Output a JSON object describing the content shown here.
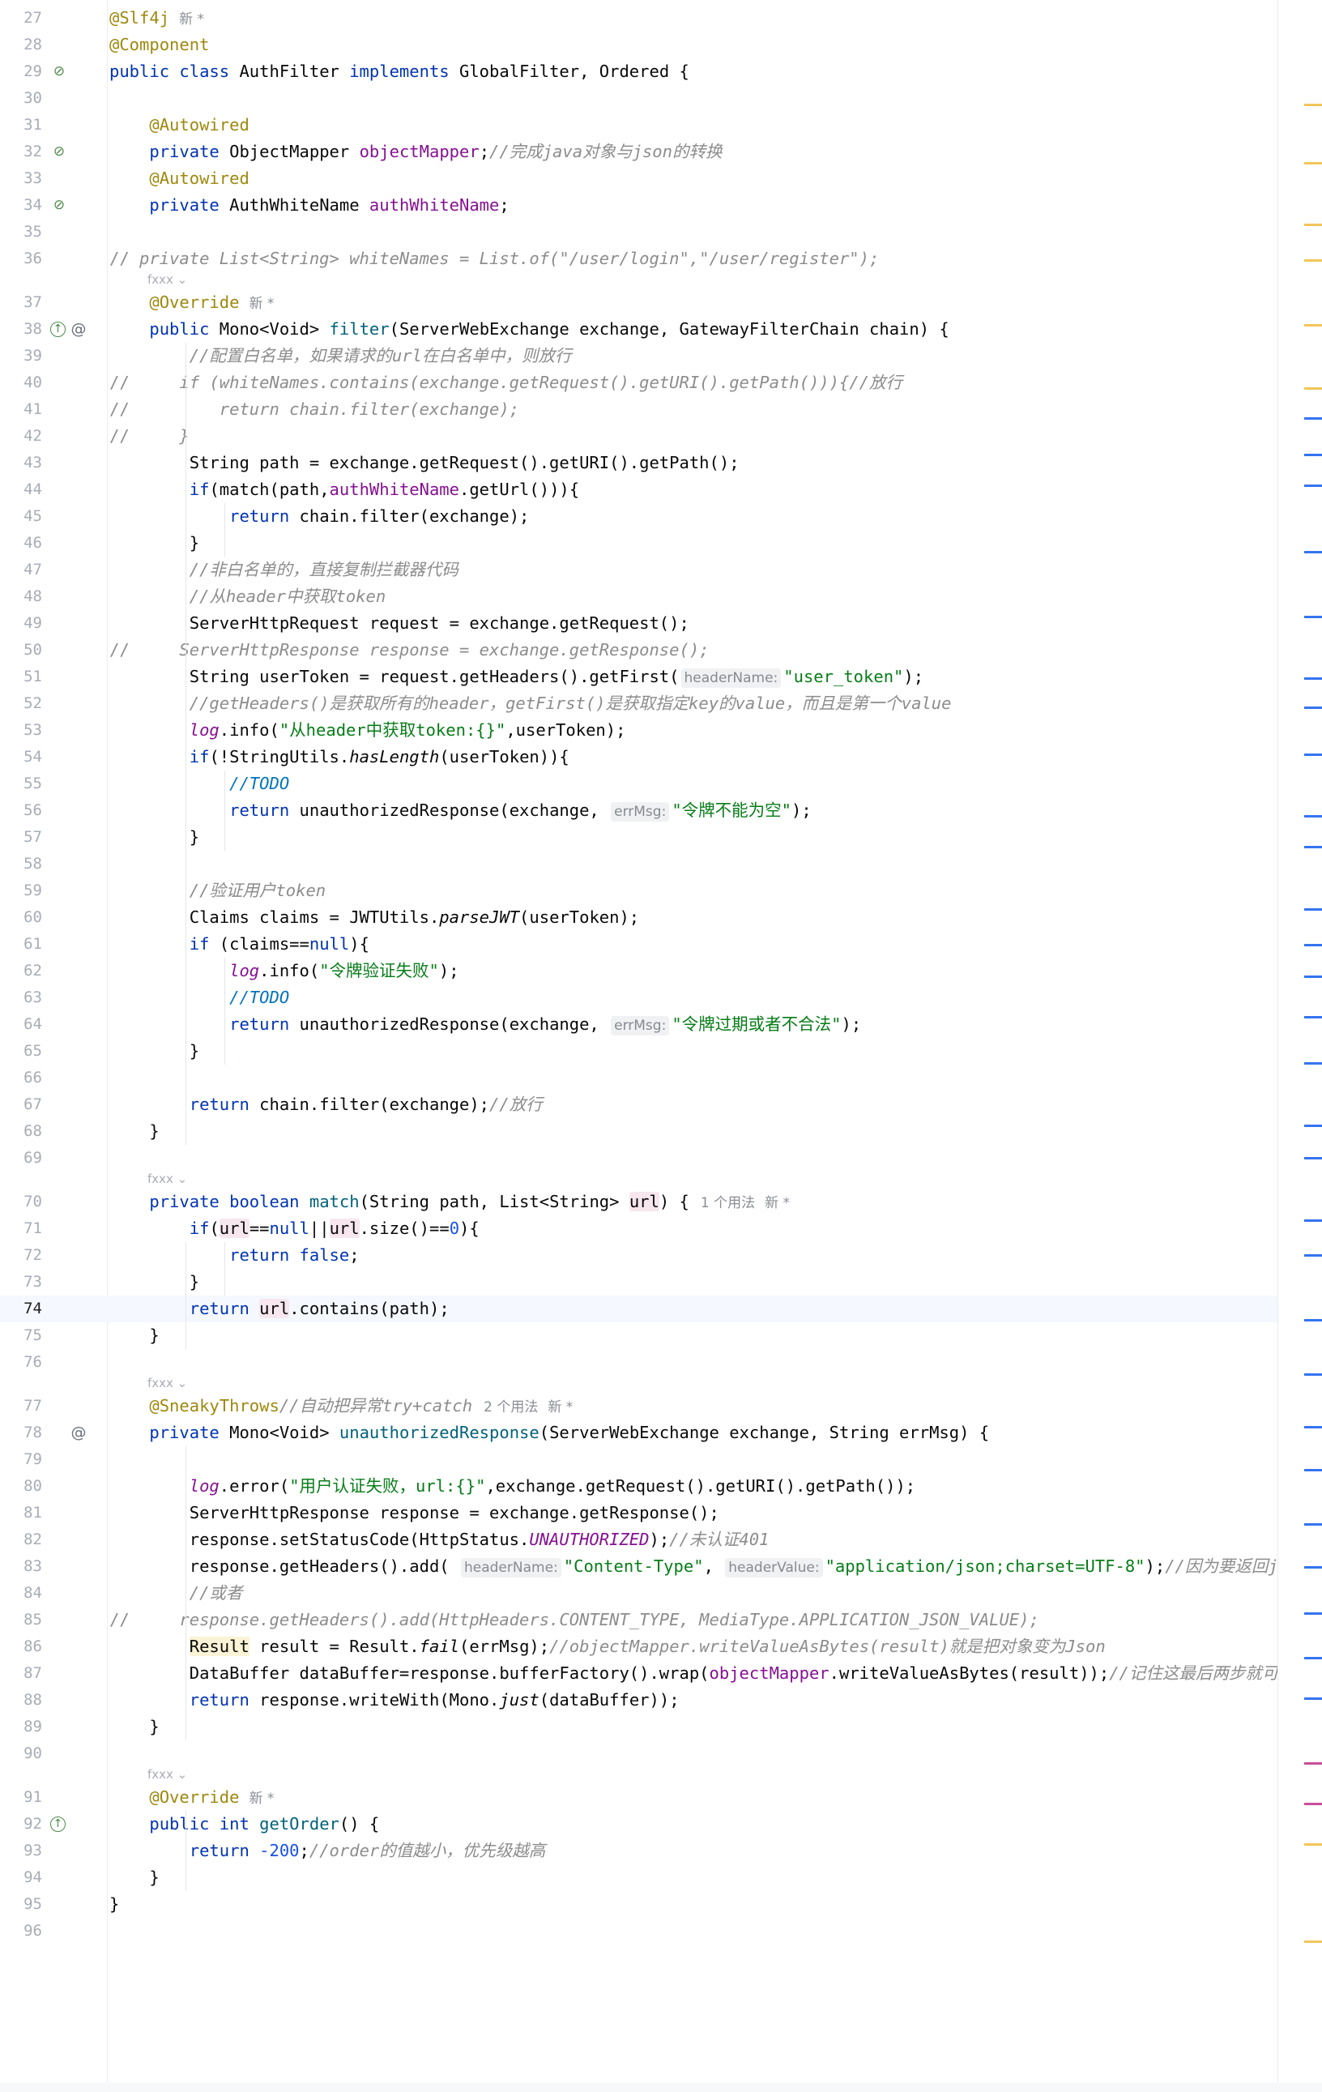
{
  "editor": {
    "gutter_authors": [
      "fxxx",
      "fxxx",
      "fxxx",
      "fxxx"
    ],
    "lines": [
      {
        "n": "27",
        "tokens": [
          [
            "an",
            "@Slf4j"
          ]
        ],
        "tail": {
          "newmark": "新 *"
        }
      },
      {
        "n": "28",
        "tokens": [
          [
            "an",
            "@Component"
          ]
        ]
      },
      {
        "n": "29",
        "icon": "bean",
        "tokens": [
          [
            "kw",
            "public class "
          ],
          [
            "",
            "AuthFilter "
          ],
          [
            "kw",
            "implements "
          ],
          [
            "",
            "GlobalFilter, Ordered {"
          ]
        ]
      },
      {
        "n": "30",
        "tokens": []
      },
      {
        "n": "31",
        "tokens": [
          [
            "",
            "    "
          ],
          [
            "an",
            "@Autowired"
          ]
        ]
      },
      {
        "n": "32",
        "icon": "bean",
        "tokens": [
          [
            "",
            "    "
          ],
          [
            "kw",
            "private "
          ],
          [
            "",
            "ObjectMapper "
          ],
          [
            "fd",
            "objectMapper"
          ],
          [
            "",
            ";"
          ],
          [
            "cm",
            "//完成java对象与json的转换"
          ]
        ]
      },
      {
        "n": "33",
        "tokens": [
          [
            "",
            "    "
          ],
          [
            "an",
            "@Autowired"
          ]
        ]
      },
      {
        "n": "34",
        "icon": "bean",
        "tokens": [
          [
            "",
            "    "
          ],
          [
            "kw",
            "private "
          ],
          [
            "",
            "AuthWhiteName "
          ],
          [
            "fd",
            "authWhiteName"
          ],
          [
            "",
            ";"
          ]
        ]
      },
      {
        "n": "35",
        "tokens": []
      },
      {
        "n": "36",
        "comment_prefix": "//",
        "tokens": [
          [
            "cm",
            "   private List<String> whiteNames = List.of(\"/user/login\",\"/user/register\");"
          ]
        ]
      },
      {
        "n": "37",
        "tokens": [
          [
            "",
            "    "
          ],
          [
            "an",
            "@Override"
          ]
        ],
        "tail": {
          "newmark": "新 *"
        }
      },
      {
        "n": "38",
        "icon": "override-at",
        "tokens": [
          [
            "",
            "    "
          ],
          [
            "kw",
            "public "
          ],
          [
            "",
            "Mono<Void> "
          ],
          [
            "fn",
            "filter"
          ],
          [
            "",
            "(ServerWebExchange exchange, GatewayFilterChain chain) {"
          ]
        ]
      },
      {
        "n": "39",
        "tokens": [
          [
            "",
            "        "
          ],
          [
            "cm",
            "//配置白名单，如果请求的url在白名单中，则放行"
          ]
        ]
      },
      {
        "n": "40",
        "comment_prefix": "//",
        "tokens": [
          [
            "cm",
            "       if (whiteNames.contains(exchange.getRequest().getURI().getPath())){//放行"
          ]
        ]
      },
      {
        "n": "41",
        "comment_prefix": "//",
        "tokens": [
          [
            "cm",
            "           return chain.filter(exchange);"
          ]
        ]
      },
      {
        "n": "42",
        "comment_prefix": "//",
        "tokens": [
          [
            "cm",
            "       }"
          ]
        ]
      },
      {
        "n": "43",
        "tokens": [
          [
            "",
            "        String path = exchange.getRequest().getURI().getPath();"
          ]
        ]
      },
      {
        "n": "44",
        "tokens": [
          [
            "",
            "        "
          ],
          [
            "kw",
            "if"
          ],
          [
            "",
            "(match(path,"
          ],
          [
            "fd",
            "authWhiteName"
          ],
          [
            "",
            ".getUrl())){"
          ]
        ]
      },
      {
        "n": "45",
        "tokens": [
          [
            "",
            "            "
          ],
          [
            "kw",
            "return "
          ],
          [
            "",
            "chain.filter(exchange);"
          ]
        ]
      },
      {
        "n": "46",
        "tokens": [
          [
            "",
            "        }"
          ]
        ]
      },
      {
        "n": "47",
        "tokens": [
          [
            "",
            "        "
          ],
          [
            "cm",
            "//非白名单的，直接复制拦截器代码"
          ]
        ]
      },
      {
        "n": "48",
        "tokens": [
          [
            "",
            "        "
          ],
          [
            "cm",
            "//从header中获取token"
          ]
        ]
      },
      {
        "n": "49",
        "tokens": [
          [
            "",
            "        ServerHttpRequest request = exchange.getRequest();"
          ]
        ]
      },
      {
        "n": "50",
        "comment_prefix": "//",
        "tokens": [
          [
            "cm",
            "       ServerHttpResponse response = exchange.getResponse();"
          ]
        ]
      },
      {
        "n": "51",
        "tokens": [
          [
            "",
            "        String userToken = request.getHeaders().getFirst("
          ],
          [
            "hint",
            "headerName:"
          ],
          [
            "st",
            "\"user_token\""
          ],
          [
            "",
            ");"
          ]
        ]
      },
      {
        "n": "52",
        "tokens": [
          [
            "",
            "        "
          ],
          [
            "cm",
            "//getHeaders()是获取所有的header，getFirst()是获取指定key的value，而且是第一个value"
          ]
        ]
      },
      {
        "n": "53",
        "tokens": [
          [
            "",
            "        "
          ],
          [
            "sfd",
            "log"
          ],
          [
            "",
            ".info("
          ],
          [
            "st",
            "\"从header中获取token:{}\""
          ],
          [
            "",
            ",userToken);"
          ]
        ]
      },
      {
        "n": "54",
        "tokens": [
          [
            "",
            "        "
          ],
          [
            "kw",
            "if"
          ],
          [
            "",
            "(!StringUtils."
          ],
          [
            "sfn",
            "hasLength"
          ],
          [
            "",
            "(userToken)){"
          ]
        ]
      },
      {
        "n": "55",
        "tokens": [
          [
            "",
            "            "
          ],
          [
            "todo",
            "//TODO"
          ]
        ]
      },
      {
        "n": "56",
        "tokens": [
          [
            "",
            "            "
          ],
          [
            "kw",
            "return "
          ],
          [
            "",
            "unauthorizedResponse(exchange, "
          ],
          [
            "hint",
            "errMsg:"
          ],
          [
            "st",
            "\"令牌不能为空\""
          ],
          [
            "",
            ");"
          ]
        ]
      },
      {
        "n": "57",
        "tokens": [
          [
            "",
            "        }"
          ]
        ]
      },
      {
        "n": "58",
        "tokens": []
      },
      {
        "n": "59",
        "tokens": [
          [
            "",
            "        "
          ],
          [
            "cm",
            "//验证用户token"
          ]
        ]
      },
      {
        "n": "60",
        "tokens": [
          [
            "",
            "        Claims claims = JWTUtils."
          ],
          [
            "sfn",
            "parseJWT"
          ],
          [
            "",
            "(userToken);"
          ]
        ]
      },
      {
        "n": "61",
        "tokens": [
          [
            "",
            "        "
          ],
          [
            "kw",
            "if "
          ],
          [
            "",
            "(claims=="
          ],
          [
            "kw",
            "null"
          ],
          [
            "",
            "){"
          ]
        ]
      },
      {
        "n": "62",
        "tokens": [
          [
            "",
            "            "
          ],
          [
            "sfd",
            "log"
          ],
          [
            "",
            ".info("
          ],
          [
            "st",
            "\"令牌验证失败\""
          ],
          [
            "",
            ");"
          ]
        ]
      },
      {
        "n": "63",
        "tokens": [
          [
            "",
            "            "
          ],
          [
            "todo",
            "//TODO"
          ]
        ]
      },
      {
        "n": "64",
        "tokens": [
          [
            "",
            "            "
          ],
          [
            "kw",
            "return "
          ],
          [
            "",
            "unauthorizedResponse(exchange, "
          ],
          [
            "hint",
            "errMsg:"
          ],
          [
            "st",
            "\"令牌过期或者不合法\""
          ],
          [
            "",
            ");"
          ]
        ]
      },
      {
        "n": "65",
        "tokens": [
          [
            "",
            "        }"
          ]
        ]
      },
      {
        "n": "66",
        "tokens": []
      },
      {
        "n": "67",
        "tokens": [
          [
            "",
            "        "
          ],
          [
            "kw",
            "return "
          ],
          [
            "",
            "chain.filter(exchange);"
          ],
          [
            "cm",
            "//放行"
          ]
        ]
      },
      {
        "n": "68",
        "tokens": [
          [
            "",
            "    }"
          ]
        ]
      },
      {
        "n": "69",
        "tokens": []
      },
      {
        "n": "70",
        "tokens": [
          [
            "",
            "    "
          ],
          [
            "kw",
            "private boolean "
          ],
          [
            "fn",
            "match"
          ],
          [
            "",
            "(String path, List<String> "
          ],
          [
            "uhl",
            "url"
          ],
          [
            "",
            ") {"
          ]
        ],
        "tail": {
          "usage": "1 个用法",
          "newmark": "新 *"
        }
      },
      {
        "n": "71",
        "tokens": [
          [
            "",
            "        "
          ],
          [
            "kw",
            "if"
          ],
          [
            "",
            "("
          ],
          [
            "uhl",
            "url"
          ],
          [
            "",
            "=="
          ],
          [
            "kw",
            "null"
          ],
          [
            "",
            "||"
          ],
          [
            "uhl",
            "url"
          ],
          [
            "",
            ".size()=="
          ],
          [
            "num",
            "0"
          ],
          [
            "",
            "){"
          ]
        ]
      },
      {
        "n": "72",
        "tokens": [
          [
            "",
            "            "
          ],
          [
            "kw",
            "return false"
          ],
          [
            "",
            ";"
          ]
        ]
      },
      {
        "n": "73",
        "tokens": [
          [
            "",
            "        }"
          ]
        ]
      },
      {
        "n": "74",
        "current": true,
        "tokens": [
          [
            "",
            "        "
          ],
          [
            "kw",
            "return "
          ],
          [
            "uhl",
            "url"
          ],
          [
            "",
            ".contains(path);"
          ]
        ]
      },
      {
        "n": "75",
        "tokens": [
          [
            "",
            "    }"
          ]
        ]
      },
      {
        "n": "76",
        "tokens": []
      },
      {
        "n": "77",
        "tokens": [
          [
            "",
            "    "
          ],
          [
            "an",
            "@SneakyThrows"
          ],
          [
            "cm",
            "//自动把异常try+catch"
          ]
        ],
        "tail": {
          "usage": "2 个用法",
          "newmark": "新 *"
        }
      },
      {
        "n": "78",
        "icon": "at",
        "tokens": [
          [
            "",
            "    "
          ],
          [
            "kw",
            "private "
          ],
          [
            "",
            "Mono<Void> "
          ],
          [
            "fn",
            "unauthorizedResponse"
          ],
          [
            "",
            "(ServerWebExchange exchange, String errMsg) {"
          ]
        ]
      },
      {
        "n": "79",
        "tokens": []
      },
      {
        "n": "80",
        "tokens": [
          [
            "",
            "        "
          ],
          [
            "sfd",
            "log"
          ],
          [
            "",
            ".error("
          ],
          [
            "st",
            "\"用户认证失败，url:{}\""
          ],
          [
            "",
            ",exchange.getRequest().getURI().getPath());"
          ]
        ]
      },
      {
        "n": "81",
        "tokens": [
          [
            "",
            "        ServerHttpResponse response = exchange.getResponse();"
          ]
        ]
      },
      {
        "n": "82",
        "tokens": [
          [
            "",
            "        response.setStatusCode(HttpStatus."
          ],
          [
            "sfd",
            "UNAUTHORIZED"
          ],
          [
            "",
            ");"
          ],
          [
            "cm",
            "//未认证401"
          ]
        ]
      },
      {
        "n": "83",
        "tokens": [
          [
            "",
            "        response.getHeaders().add( "
          ],
          [
            "hint",
            "headerName:"
          ],
          [
            "st",
            "\"Content-Type\""
          ],
          [
            "",
            ", "
          ],
          [
            "hint",
            "headerValue:"
          ],
          [
            "st",
            "\"application/json;charset=UTF-8\""
          ],
          [
            "",
            ");"
          ],
          [
            "cm",
            "//因为要返回json"
          ]
        ]
      },
      {
        "n": "84",
        "tokens": [
          [
            "",
            "        "
          ],
          [
            "cm",
            "//或者"
          ]
        ]
      },
      {
        "n": "85",
        "comment_prefix": "//",
        "tokens": [
          [
            "cm",
            "       response.getHeaders().add(HttpHeaders.CONTENT_TYPE, MediaType.APPLICATION_JSON_VALUE);"
          ]
        ]
      },
      {
        "n": "86",
        "tokens": [
          [
            "",
            "        "
          ],
          [
            "whl",
            "Result"
          ],
          [
            "",
            " result = Result."
          ],
          [
            "sfn",
            "fail"
          ],
          [
            "",
            "(errMsg);"
          ],
          [
            "cm",
            "//objectMapper.writeValueAsBytes(result)就是把对象变为Json"
          ]
        ]
      },
      {
        "n": "87",
        "tokens": [
          [
            "",
            "        DataBuffer dataBuffer=response.bufferFactory().wrap("
          ],
          [
            "fd",
            "objectMapper"
          ],
          [
            "",
            ".writeValueAsBytes(result));"
          ],
          [
            "cm",
            "//记住这最后两步就可以了"
          ]
        ]
      },
      {
        "n": "88",
        "tokens": [
          [
            "",
            "        "
          ],
          [
            "kw",
            "return "
          ],
          [
            "",
            "response.writeWith(Mono."
          ],
          [
            "sfn",
            "just"
          ],
          [
            "",
            "(dataBuffer));"
          ]
        ]
      },
      {
        "n": "89",
        "tokens": [
          [
            "",
            "    }"
          ]
        ]
      },
      {
        "n": "90",
        "tokens": []
      },
      {
        "n": "91",
        "tokens": [
          [
            "",
            "    "
          ],
          [
            "an",
            "@Override"
          ]
        ],
        "tail": {
          "newmark": "新 *"
        }
      },
      {
        "n": "92",
        "icon": "override",
        "tokens": [
          [
            "",
            "    "
          ],
          [
            "kw",
            "public int "
          ],
          [
            "fn",
            "getOrder"
          ],
          [
            "",
            "() {"
          ]
        ]
      },
      {
        "n": "93",
        "tokens": [
          [
            "",
            "        "
          ],
          [
            "kw",
            "return "
          ],
          [
            "num",
            "-200"
          ],
          [
            "",
            ";"
          ],
          [
            "cm",
            "//order的值越小，优先级越高"
          ]
        ]
      },
      {
        "n": "94",
        "tokens": [
          [
            "",
            "    }"
          ]
        ]
      },
      {
        "n": "95",
        "tokens": [
          [
            "",
            "}"
          ]
        ]
      },
      {
        "n": "96",
        "tokens": []
      }
    ]
  },
  "colors": {
    "keyword": "#0033b3",
    "annotation": "#9e880d",
    "field": "#871094",
    "method": "#00627a",
    "string": "#067d17",
    "comment": "#8c8c8c",
    "number": "#1750eb",
    "todo": "#0073bf",
    "scrollbar_marks": [
      "#f2c55c",
      "#3574f0",
      "#c94f9a"
    ]
  }
}
